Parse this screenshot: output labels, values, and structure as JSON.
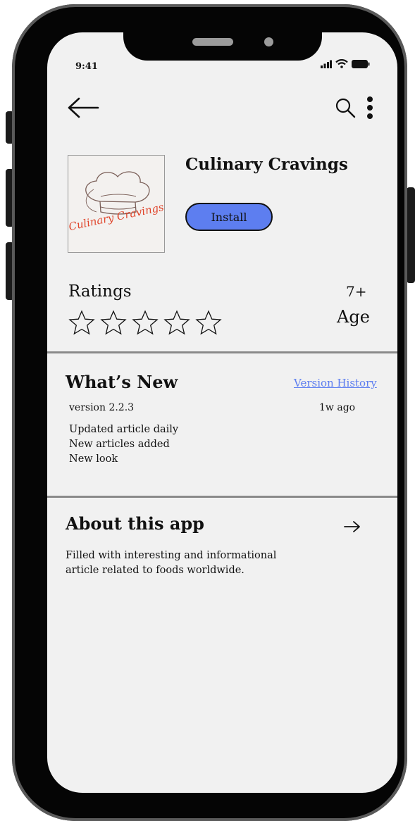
{
  "status_bar": {
    "time": "9:41"
  },
  "app": {
    "title": "Culinary Cravings",
    "icon_text": "Culinary Cravings",
    "install_label": "Install"
  },
  "ratings": {
    "label": "Ratings",
    "stars_filled": 0,
    "stars_total": 5,
    "age_value": "7+",
    "age_label": "Age"
  },
  "whats_new": {
    "title": "What’s New",
    "version_history_link": "Version History",
    "version": "version 2.2.3",
    "updated": "1w ago",
    "notes": [
      "Updated article daily",
      "New articles added",
      "New look"
    ]
  },
  "about": {
    "title": "About this app",
    "description": "Filled with interesting and informational article related to foods worldwide."
  },
  "colors": {
    "accent": "#5d7ef0",
    "logo_text": "#e0452b",
    "screen_bg": "#f1f1f1"
  }
}
